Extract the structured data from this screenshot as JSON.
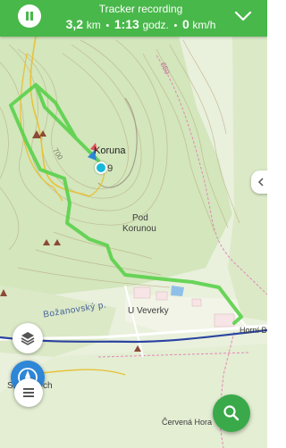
{
  "tracker": {
    "title": "Tracker recording",
    "distance_value": "3,2",
    "distance_unit": "km",
    "time_value": "1:13",
    "time_unit": "godz.",
    "speed_value": "0",
    "speed_unit": "km/h",
    "separator": "•"
  },
  "map": {
    "labels": {
      "koruna": "Koruna",
      "elevation": "69",
      "pod": "Pod",
      "korunou": "Korunou",
      "road": "Božanovský p.",
      "u_veverky": "U Veverky",
      "horni": "Horní B",
      "cervena_hora": "Červená Hora",
      "sm_ch": "Sm",
      "sm_ch_tail": "ch",
      "contour_700": "700",
      "contour_650": "650"
    },
    "colors": {
      "background": "#e9f0dc",
      "track": "#5ad04a",
      "trail_yellow": "#e8c23a",
      "road_blue": "#2b43a0",
      "forest": "#cfe2b6",
      "water": "#8fc0e8",
      "top_bar": "#48b84a",
      "search_fab": "#3aa94a"
    }
  },
  "controls": {
    "pause_icon": "pause-icon",
    "collapse_icon": "chevron-down-icon",
    "layers_icon": "layers-icon",
    "compass_icon": "compass-icon",
    "menu_icon": "menu-icon",
    "search_icon": "search-icon",
    "side_icon": "chevron-left-icon"
  }
}
